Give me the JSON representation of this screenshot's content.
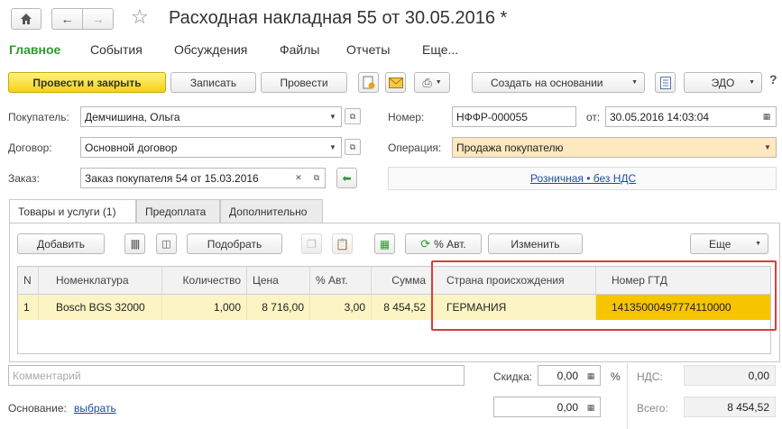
{
  "window": {
    "title": "Расходная накладная 55 от 30.05.2016 *"
  },
  "menu": {
    "items": [
      "Главное",
      "События",
      "Обсуждения",
      "Файлы",
      "Отчеты",
      "Еще..."
    ]
  },
  "toolbar": {
    "post_close": "Провести и закрыть",
    "save": "Записать",
    "post": "Провести",
    "create_based": "Создать на основании",
    "edo": "ЭДО"
  },
  "form": {
    "buyer_label": "Покупатель:",
    "buyer_value": "Демчишина, Ольга",
    "contract_label": "Договор:",
    "contract_value": "Основной договор",
    "order_label": "Заказ:",
    "order_value": "Заказ покупателя 54 от 15.03.2016",
    "number_label": "Номер:",
    "number_value": "НФФР-000055",
    "date_label": "от:",
    "date_value": "30.05.2016 14:03:04",
    "operation_label": "Операция:",
    "operation_value": "Продажа покупателю",
    "price_link": "Розничная • без НДС"
  },
  "tabs": [
    "Товары и услуги (1)",
    "Предоплата",
    "Дополнительно"
  ],
  "table_toolbar": {
    "add": "Добавить",
    "pick": "Подобрать",
    "auto_pct": "% Авт.",
    "change": "Изменить",
    "more": "Еще"
  },
  "table": {
    "columns": [
      "N",
      "Номенклатура",
      "Количество",
      "Цена",
      "% Авт.",
      "Сумма",
      "Страна происхождения",
      "Номер ГТД"
    ],
    "rows": [
      [
        "1",
        "Bosch BGS 32000",
        "1,000",
        "8 716,00",
        "3,00",
        "8 454,52",
        "ГЕРМАНИЯ",
        "14135000497774110000"
      ]
    ]
  },
  "footer": {
    "comment_placeholder": "Комментарий",
    "discount_label": "Скидка:",
    "discount_value": "0,00",
    "pct_sign": "%",
    "vat_label": "НДС:",
    "vat_value": "0,00",
    "basis_label": "Основание:",
    "basis_link": "выбрать",
    "amount_value": "0,00",
    "total_label": "Всего:",
    "total_value": "8 454,52"
  },
  "colors": {
    "accent_green": "#2d9b2d",
    "primary_yellow": "#f4d21c",
    "highlight_row": "#fcf5c3",
    "gtd_cell": "#f6c500",
    "annotation_red": "#e0393e"
  }
}
